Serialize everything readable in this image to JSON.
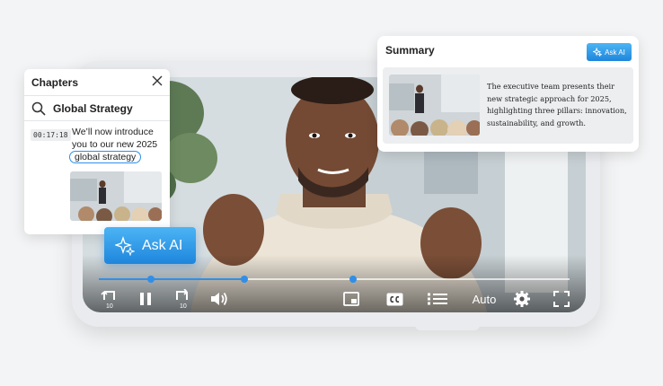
{
  "chapters": {
    "title": "Chapters",
    "search_value": "Global Strategy",
    "entry": {
      "timestamp": "00:17:18",
      "text": "We’ll now introduce you to our new 2025",
      "highlight": "global strategy"
    }
  },
  "ask_ai": {
    "label": "Ask AI"
  },
  "summary": {
    "title": "Summary",
    "ask_ai_label": "Ask AI",
    "text": "The executive team presents their new strategic approach for 2025, highlighting three pillars: innovation, sustainability, and growth."
  },
  "player": {
    "rewind_label": "10",
    "forward_label": "10",
    "quality_label": "Auto",
    "progress_fraction": 0.31,
    "chapter_markers": [
      0.11,
      0.31,
      0.54
    ],
    "accent_color": "#2f8fe8"
  }
}
